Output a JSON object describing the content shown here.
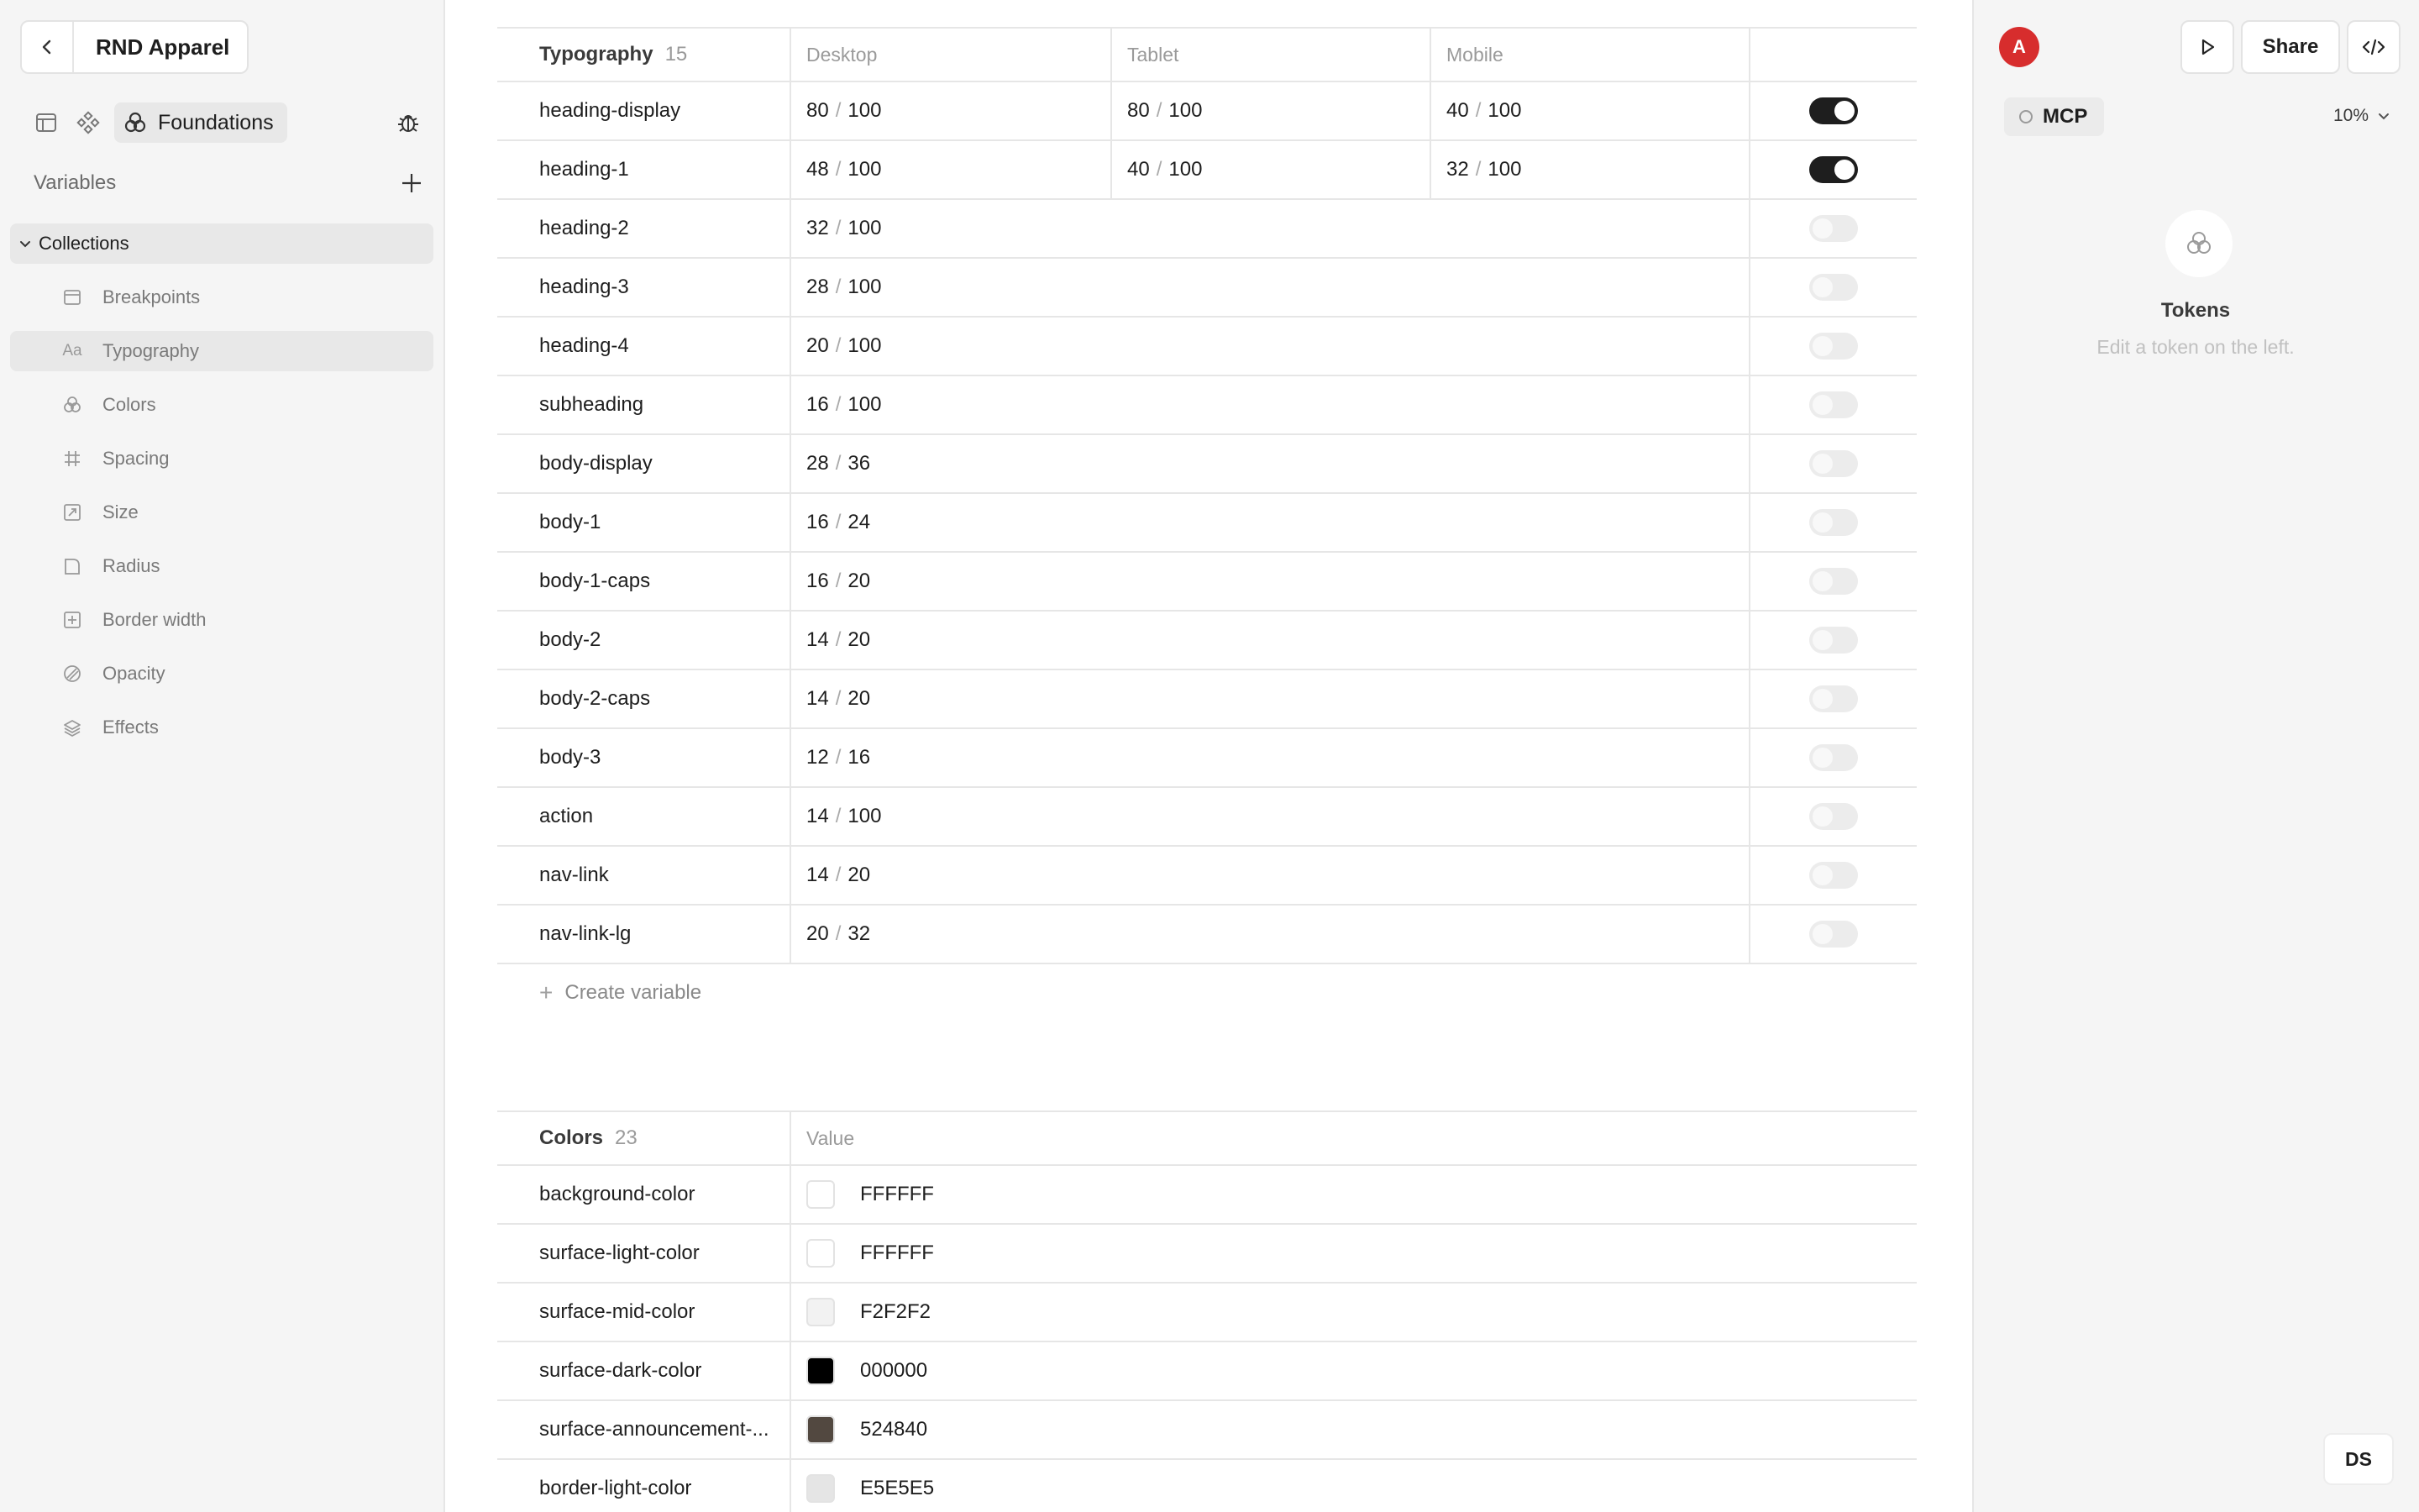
{
  "project": {
    "name": "RND Apparel"
  },
  "mode": {
    "active_label": "Foundations"
  },
  "variables": {
    "label": "Variables"
  },
  "collections": {
    "label": "Collections",
    "items": [
      {
        "label": "Breakpoints",
        "icon": "layout-icon"
      },
      {
        "label": "Typography",
        "icon": "text-aa-icon",
        "active": true
      },
      {
        "label": "Colors",
        "icon": "colors-icon"
      },
      {
        "label": "Spacing",
        "icon": "grid-hash-icon"
      },
      {
        "label": "Size",
        "icon": "resize-icon"
      },
      {
        "label": "Radius",
        "icon": "radius-icon"
      },
      {
        "label": "Border width",
        "icon": "border-icon"
      },
      {
        "label": "Opacity",
        "icon": "opacity-icon"
      },
      {
        "label": "Effects",
        "icon": "layers-icon"
      }
    ]
  },
  "typography": {
    "title": "Typography",
    "count": "15",
    "columns": {
      "desktop": "Desktop",
      "tablet": "Tablet",
      "mobile": "Mobile"
    },
    "rows": [
      {
        "name": "heading-display",
        "desktop": [
          "80",
          "100"
        ],
        "tablet": [
          "80",
          "100"
        ],
        "mobile": [
          "40",
          "100"
        ],
        "responsive": true
      },
      {
        "name": "heading-1",
        "desktop": [
          "48",
          "100"
        ],
        "tablet": [
          "40",
          "100"
        ],
        "mobile": [
          "32",
          "100"
        ],
        "responsive": true
      },
      {
        "name": "heading-2",
        "desktop": [
          "32",
          "100"
        ],
        "responsive": false
      },
      {
        "name": "heading-3",
        "desktop": [
          "28",
          "100"
        ],
        "responsive": false
      },
      {
        "name": "heading-4",
        "desktop": [
          "20",
          "100"
        ],
        "responsive": false
      },
      {
        "name": "subheading",
        "desktop": [
          "16",
          "100"
        ],
        "responsive": false
      },
      {
        "name": "body-display",
        "desktop": [
          "28",
          "36"
        ],
        "responsive": false
      },
      {
        "name": "body-1",
        "desktop": [
          "16",
          "24"
        ],
        "responsive": false
      },
      {
        "name": "body-1-caps",
        "desktop": [
          "16",
          "20"
        ],
        "responsive": false
      },
      {
        "name": "body-2",
        "desktop": [
          "14",
          "20"
        ],
        "responsive": false
      },
      {
        "name": "body-2-caps",
        "desktop": [
          "14",
          "20"
        ],
        "responsive": false
      },
      {
        "name": "body-3",
        "desktop": [
          "12",
          "16"
        ],
        "responsive": false
      },
      {
        "name": "action",
        "desktop": [
          "14",
          "100"
        ],
        "responsive": false
      },
      {
        "name": "nav-link",
        "desktop": [
          "14",
          "20"
        ],
        "responsive": false
      },
      {
        "name": "nav-link-lg",
        "desktop": [
          "20",
          "32"
        ],
        "responsive": false
      }
    ],
    "create_label": "Create variable"
  },
  "colors": {
    "title": "Colors",
    "count": "23",
    "value_label": "Value",
    "rows": [
      {
        "name": "background-color",
        "value": "FFFFFF",
        "swatch": "#FFFFFF"
      },
      {
        "name": "surface-light-color",
        "value": "FFFFFF",
        "swatch": "#FFFFFF"
      },
      {
        "name": "surface-mid-color",
        "value": "F2F2F2",
        "swatch": "#F2F2F2"
      },
      {
        "name": "surface-dark-color",
        "value": "000000",
        "swatch": "#000000"
      },
      {
        "name": "surface-announcement-...",
        "value": "524840",
        "swatch": "#524840"
      },
      {
        "name": "border-light-color",
        "value": "E5E5E5",
        "swatch": "#E5E5E5"
      }
    ]
  },
  "right_panel": {
    "avatar_letter": "A",
    "avatar_color": "#D72D2D",
    "share_label": "Share",
    "mcp_label": "MCP",
    "zoom": "10%",
    "tokens_title": "Tokens",
    "tokens_hint": "Edit a token on the left.",
    "ds_label": "DS"
  }
}
